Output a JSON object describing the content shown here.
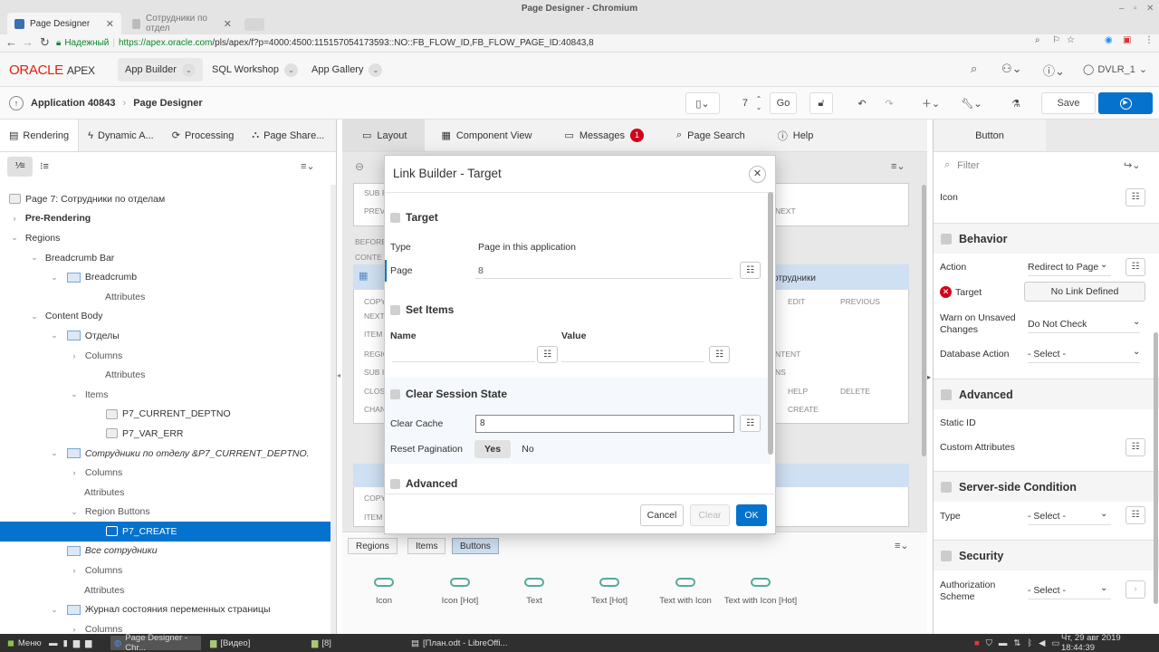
{
  "browser": {
    "window_title": "Page Designer - Chromium",
    "tabs": [
      {
        "label": "Page Designer",
        "active": true
      },
      {
        "label": "Сотрудники по отдел",
        "active": false
      }
    ],
    "secure_label": "Надежный",
    "url_scheme_host": "https://apex.oracle.com",
    "url_path": "/pls/apex/f?p=4000:4500:115157054173593::NO::FB_FLOW_ID,FB_FLOW_PAGE_ID:40843,8"
  },
  "apex": {
    "logo_oracle": "ORACLE",
    "logo_apex": "APEX",
    "nav": [
      "App Builder",
      "SQL Workshop",
      "App Gallery"
    ],
    "user": "DVLR_1"
  },
  "pd_toolbar": {
    "application": "Application 40843",
    "crumb": "Page Designer",
    "page_number": "7",
    "go_label": "Go",
    "save_label": "Save"
  },
  "left_panel": {
    "tabs": [
      "Rendering",
      "Dynamic A...",
      "Processing",
      "Page Share..."
    ],
    "tree": {
      "page": "Page 7: Сотрудники по отделам",
      "pre_rendering": "Pre-Rendering",
      "regions": "Regions",
      "breadcrumb_bar": "Breadcrumb Bar",
      "breadcrumb": "Breadcrumb",
      "attributes": "Attributes",
      "content_body": "Content Body",
      "otdely": "Отделы",
      "columns": "Columns",
      "items": "Items",
      "item1": "P7_CURRENT_DEPTNO",
      "item2": "P7_VAR_ERR",
      "sotrudniki_po_otdelu": "Сотрудники по отделу &P7_CURRENT_DEPTNO.",
      "region_buttons": "Region Buttons",
      "create_button": "P7_CREATE",
      "vse_sotrudniki": "Все сотрудники",
      "zhurnal": "Журнал состояния переменных страницы"
    }
  },
  "center": {
    "tabs": [
      "Layout",
      "Component View",
      "Messages",
      "Page Search",
      "Help"
    ],
    "messages_count": "1",
    "ghost": {
      "sub": "SUB R",
      "prev": "PREVI",
      "next": "NEXT",
      "before": "BEFORE",
      "content": "CONTE",
      "title": "отрудники",
      "copy": "COPY",
      "nexth": "NEXT",
      "item": "ITEM",
      "edit": "EDIT",
      "previous": "PREVIOUS",
      "regio": "REGIO",
      "ntent": "NTENT",
      "subi": "SUB I",
      "ns": "NS",
      "clos": "CLOS",
      "help": "HELP",
      "delete": "DELETE",
      "chan": "CHAN",
      "create": "CREATE"
    },
    "gallery_tabs": [
      "Regions",
      "Items",
      "Buttons"
    ],
    "gallery_items": [
      "Icon",
      "Icon [Hot]",
      "Text",
      "Text [Hot]",
      "Text with Icon",
      "Text with Icon [Hot]"
    ]
  },
  "right_panel": {
    "header": "Button",
    "filter_placeholder": "Filter",
    "icon_label": "Icon",
    "behavior": "Behavior",
    "action_label": "Action",
    "action_value": "Redirect to Page",
    "target_label": "Target",
    "target_value": "No Link Defined",
    "warn_label": "Warn on Unsaved Changes",
    "warn_value": "Do Not Check",
    "db_action_label": "Database Action",
    "db_action_value": "- Select -",
    "advanced": "Advanced",
    "static_id": "Static ID",
    "custom_attrs": "Custom Attributes",
    "server_side": "Server-side Condition",
    "type_label": "Type",
    "type_value": "- Select -",
    "security": "Security",
    "auth_label": "Authorization Scheme",
    "auth_value": "- Select -"
  },
  "dialog": {
    "title": "Link Builder - Target",
    "target_section": "Target",
    "type_label": "Type",
    "type_value": "Page in this application",
    "page_label": "Page",
    "page_value": "8",
    "set_items": "Set Items",
    "name_header": "Name",
    "value_header": "Value",
    "clear_session": "Clear Session State",
    "clear_cache_label": "Clear Cache",
    "clear_cache_value": "8",
    "reset_pagination_label": "Reset Pagination",
    "yes": "Yes",
    "no": "No",
    "advanced": "Advanced",
    "cancel": "Cancel",
    "clear": "Clear",
    "ok": "OK"
  },
  "taskbar": {
    "menu": "Меню",
    "items": [
      "Page Designer - Chr...",
      "[Видео]",
      "[8]",
      "[План.odt - LibreOffi..."
    ],
    "clock": "Чт, 29 авг 2019 18:44:39"
  }
}
